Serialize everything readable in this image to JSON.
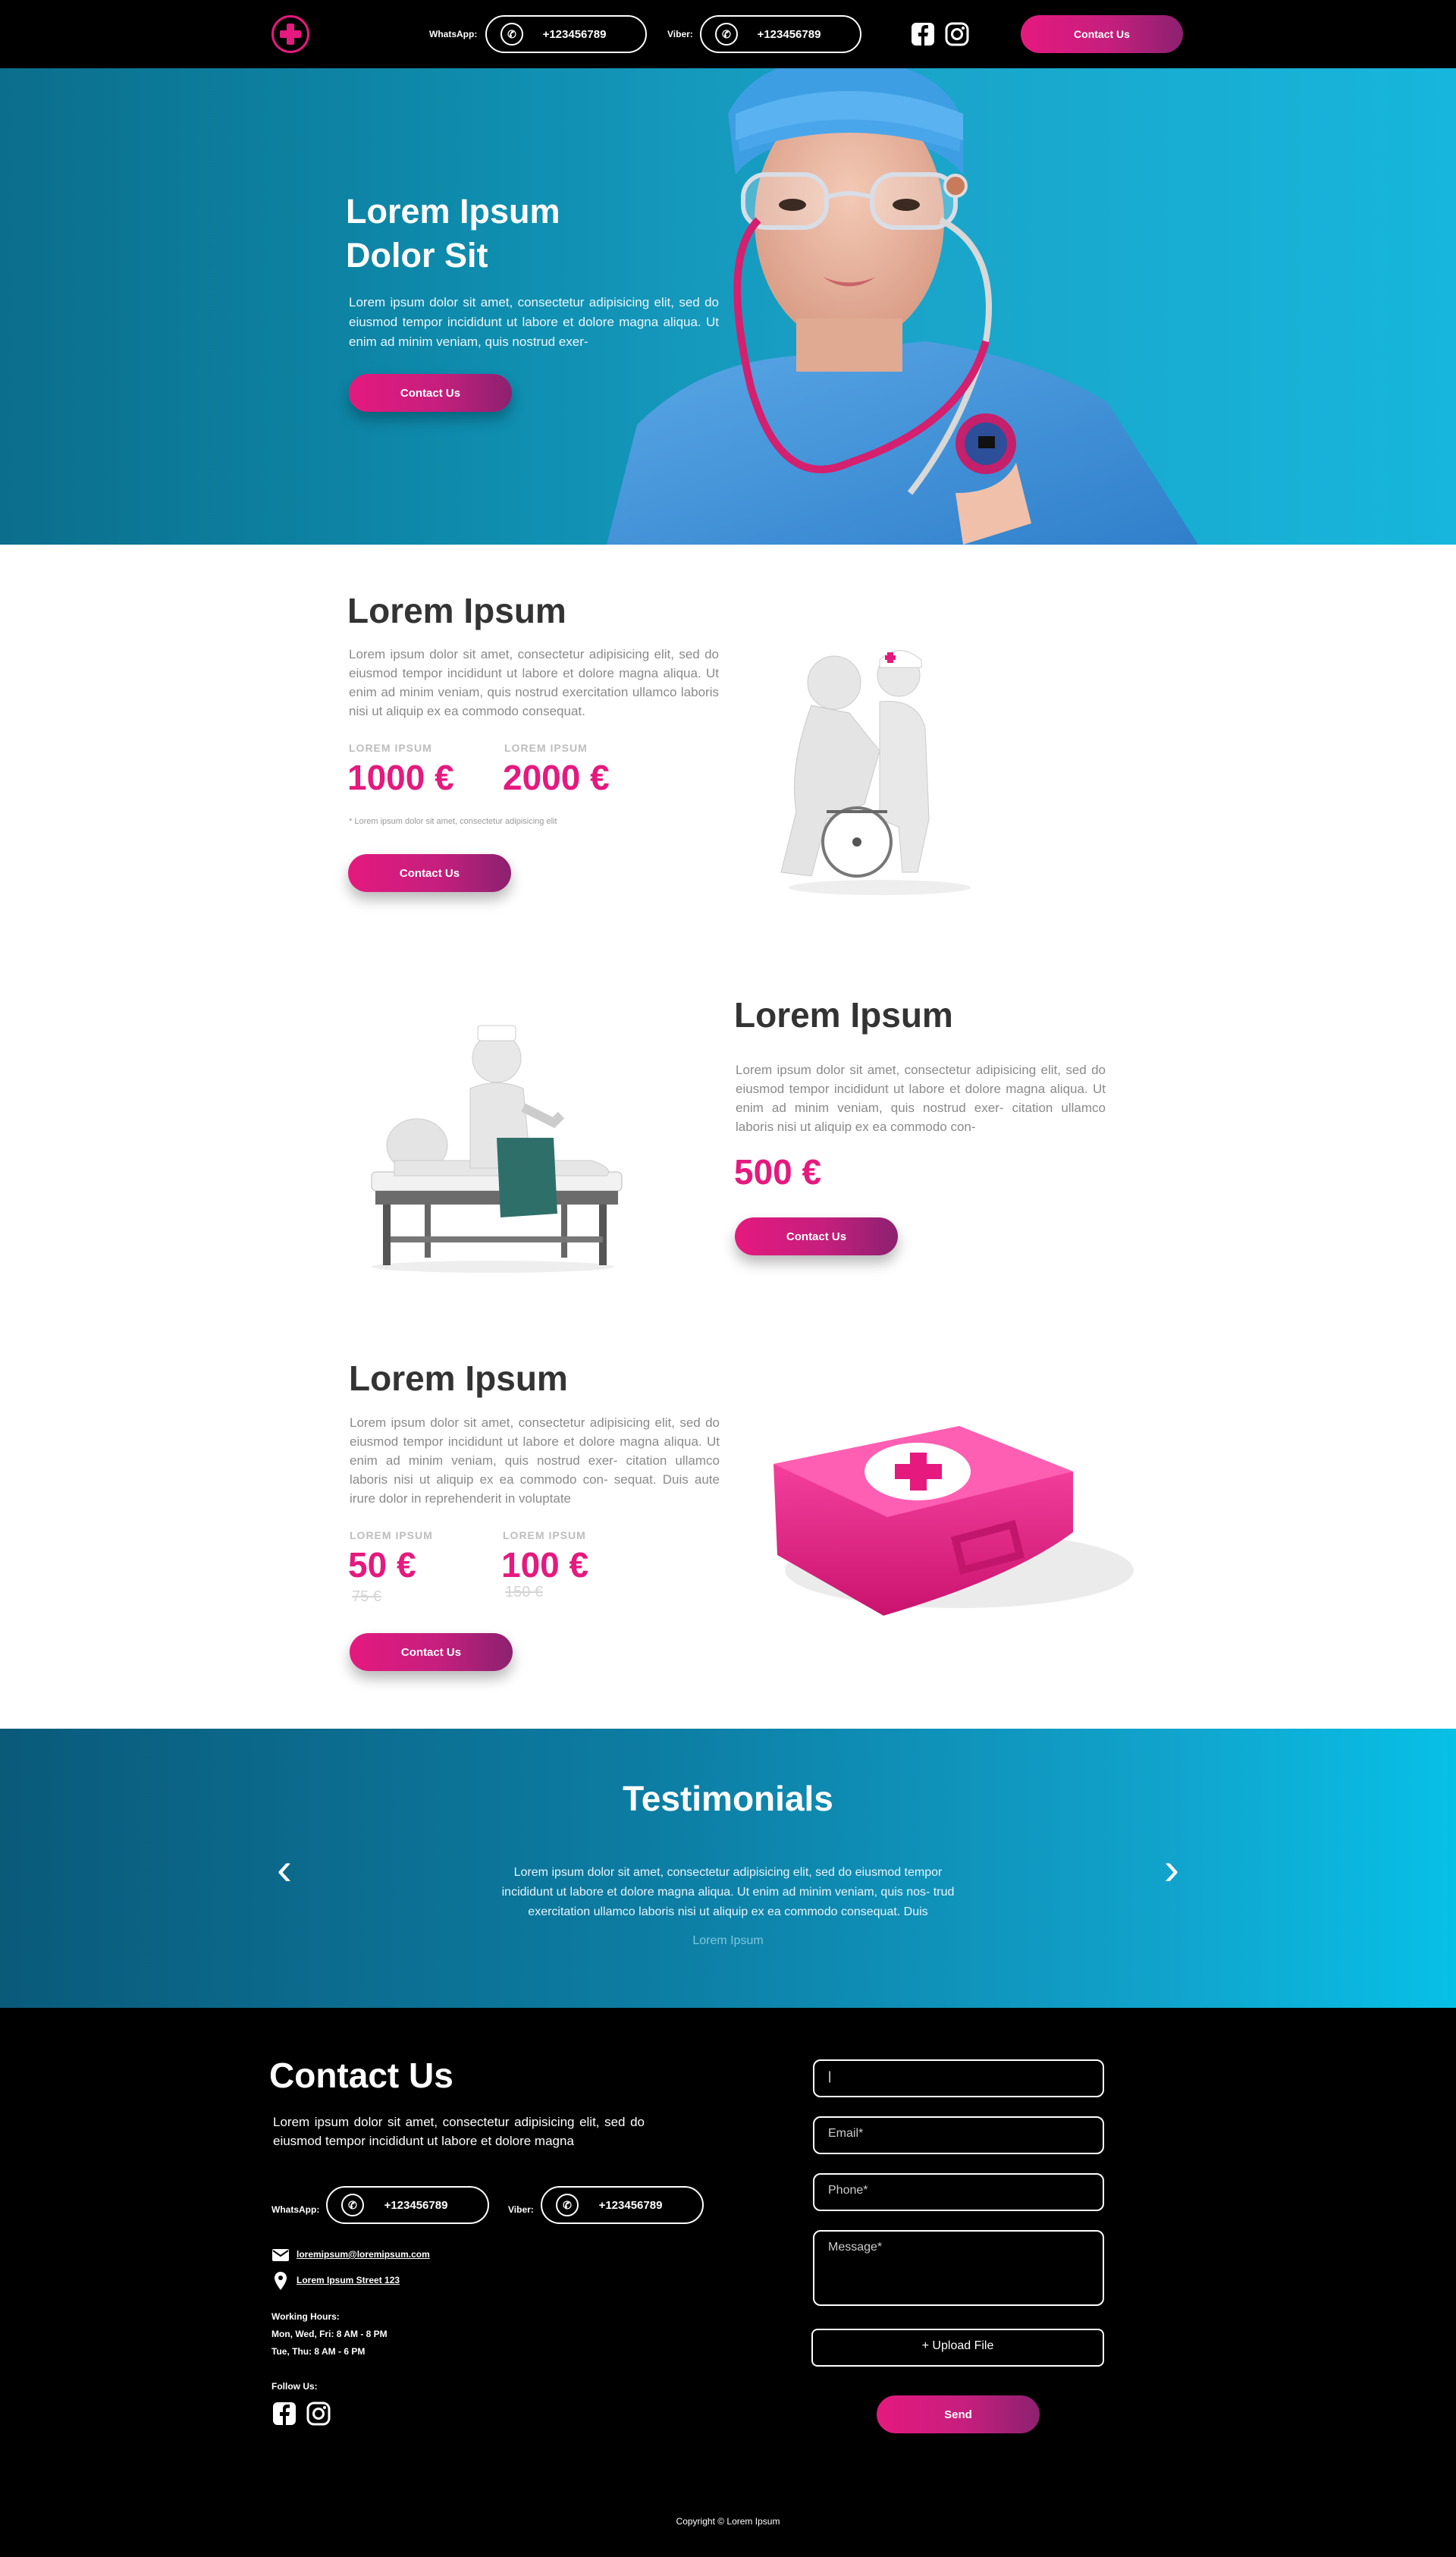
{
  "header": {
    "whatsapp_label": "WhatsApp:",
    "whatsapp_number": "+123456789",
    "viber_label": "Viber:",
    "viber_number": "+123456789",
    "contact_button": "Contact Us",
    "icons": [
      "medical-cross-logo",
      "whatsapp-icon",
      "viber-icon",
      "facebook-icon",
      "instagram-icon"
    ]
  },
  "hero": {
    "title_line1": "Lorem Ipsum",
    "title_line2": "Dolor Sit",
    "text": "Lorem ipsum dolor sit amet, consectetur adipisicing elit, sed do eiusmod tempor incididunt ut labore et dolore magna aliqua. Ut enim ad minim veniam, quis nostrud exer-",
    "button": "Contact Us"
  },
  "service1": {
    "title": "Lorem Ipsum",
    "text": "Lorem ipsum dolor sit amet, consectetur adipisicing elit, sed do eiusmod tempor incididunt ut labore et dolore magna aliqua. Ut enim ad minim veniam, quis nostrud exercitation ullamco laboris nisi ut aliquip ex ea commodo consequat.",
    "price1_label": "LOREM IPSUM",
    "price1": "1000 €",
    "price2_label": "LOREM IPSUM",
    "price2": "2000 €",
    "note": "* Lorem ipsum dolor sit amet, consectetur adipisicing elit",
    "button": "Contact Us"
  },
  "service2": {
    "title": "Lorem Ipsum",
    "text": "Lorem ipsum dolor sit amet, consectetur adipisicing elit, sed do eiusmod tempor incididunt ut labore et dolore magna aliqua. Ut enim ad minim veniam, quis nostrud exer- citation ullamco laboris nisi ut aliquip ex ea commodo con-",
    "price": "500 €",
    "button": "Contact Us"
  },
  "service3": {
    "title": "Lorem Ipsum",
    "text": "Lorem ipsum dolor sit amet, consectetur adipisicing elit, sed do eiusmod tempor incididunt ut labore et dolore magna aliqua. Ut enim ad minim veniam, quis nostrud exer- citation ullamco laboris nisi ut aliquip ex ea commodo con- sequat. Duis aute irure dolor in reprehenderit in voluptate",
    "price1_label": "LOREM IPSUM",
    "price1": "50 €",
    "price1_old": "75 €",
    "price2_label": "LOREM IPSUM",
    "price2": "100 €",
    "price2_old": "150 €",
    "button": "Contact Us"
  },
  "testimonials": {
    "title": "Testimonials",
    "text": "Lorem ipsum dolor sit amet, consectetur adipisicing elit, sed do eiusmod tempor incididunt ut labore et dolore magna aliqua. Ut enim ad minim veniam, quis nos- trud exercitation ullamco laboris nisi ut aliquip ex ea commodo consequat. Duis",
    "author": "Lorem Ipsum"
  },
  "contact": {
    "title": "Contact Us",
    "text": "Lorem ipsum dolor sit amet, consectetur adipisicing elit, sed do eiusmod tempor incididunt ut labore et dolore magna",
    "whatsapp_label": "WhatsApp:",
    "whatsapp_number": "+123456789",
    "viber_label": "Viber:",
    "viber_number": "+123456789",
    "email": "loremipsum@loremipsum.com",
    "address": "Lorem Ipsum Street 123",
    "hours_title": "Working Hours:",
    "hours_line1": "Mon, Wed, Fri: 8 AM - 8 PM",
    "hours_line2": "Tue, Thu: 8 AM - 6 PM",
    "follow_label": "Follow Us:",
    "form": {
      "name_value": "|",
      "email_placeholder": "Email*",
      "phone_placeholder": "Phone*",
      "message_placeholder": "Message*",
      "upload": "+ Upload File",
      "send": "Send"
    },
    "copyright": "Copyright © Lorem Ipsum"
  },
  "colors": {
    "accent": "#e5197e",
    "header_bg": "#000000",
    "teal": "#1aa3c8"
  }
}
